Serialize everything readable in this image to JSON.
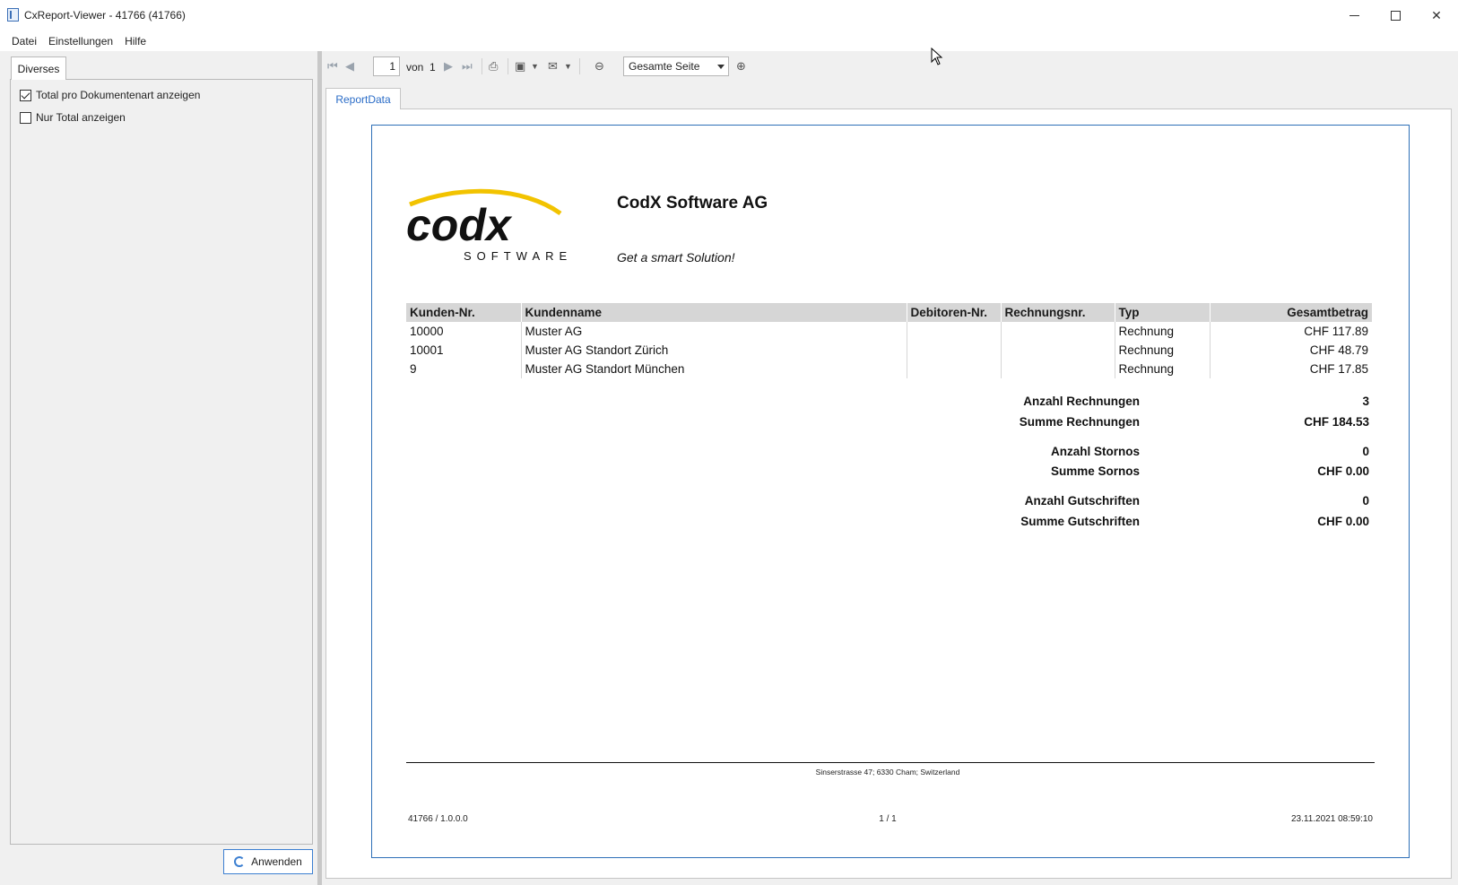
{
  "window": {
    "title": "CxReport-Viewer - 41766 (41766)"
  },
  "menu": {
    "datei": "Datei",
    "einstellungen": "Einstellungen",
    "hilfe": "Hilfe"
  },
  "left_panel": {
    "tab_label": "Diverses",
    "options": [
      {
        "label": "Total pro Dokumentenart anzeigen",
        "checked": true
      },
      {
        "label": "Nur Total anzeigen",
        "checked": false
      }
    ],
    "apply_button": "Anwenden"
  },
  "toolbar": {
    "current_page": "1",
    "of_label": "von",
    "total_pages": "1",
    "zoom_value": "Gesamte Seite"
  },
  "report_tab": "ReportData",
  "report": {
    "company": "CodX Software AG",
    "slogan": "Get a smart Solution!",
    "logo_text": "codx",
    "logo_subtext": "SOFTWARE",
    "columns": [
      "Kunden-Nr.",
      "Kundenname",
      "Debitoren-Nr.",
      "Rechnungsnr.",
      "Typ",
      "Gesamtbetrag"
    ],
    "rows": [
      [
        "10000",
        "Muster AG",
        "",
        "",
        "Rechnung",
        "CHF 117.89"
      ],
      [
        "10001",
        "Muster AG Standort Zürich",
        "",
        "",
        "Rechnung",
        "CHF 48.79"
      ],
      [
        "9",
        "Muster AG Standort München",
        "",
        "",
        "Rechnung",
        "CHF 17.85"
      ]
    ],
    "summary": {
      "anzahl_rechnungen_label": "Anzahl Rechnungen",
      "anzahl_rechnungen": "3",
      "summe_rechnungen_label": "Summe Rechnungen",
      "summe_rechnungen": "CHF 184.53",
      "anzahl_stornos_label": "Anzahl Stornos",
      "anzahl_stornos": "0",
      "summe_sornos_label": "Summe Sornos",
      "summe_sornos": "CHF 0.00",
      "anzahl_gutschriften_label": "Anzahl Gutschriften",
      "anzahl_gutschriften": "0",
      "summe_gutschriften_label": "Summe Gutschriften",
      "summe_gutschriften": "CHF 0.00"
    },
    "footer": {
      "address": "Sinserstrasse 47; 6330 Cham; Switzerland",
      "version": "41766 / 1.0.0.0",
      "page": "1 / 1",
      "timestamp": "23.11.2021 08:59:10"
    }
  },
  "colors": {
    "accent": "#2a6cc7",
    "logo_yellow": "#f2c300",
    "header_gray": "#d6d6d6"
  }
}
